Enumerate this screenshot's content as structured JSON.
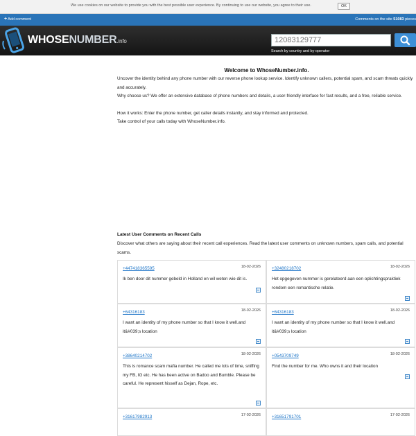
{
  "cookie": {
    "message": "We use cookies on our website to provide you with the best possible user experience. By continuing to use our website, you agree to their use.",
    "ok_label": "OK"
  },
  "topbar": {
    "add_comment_label": "Add comment",
    "comments_prefix": "Comments on the site",
    "comments_count": "51083",
    "comments_suffix": "pieces"
  },
  "header": {
    "logo_word": "WHOSE",
    "logo_word2": "NUMBER",
    "logo_tld": ".info",
    "search_placeholder": "12083129777",
    "search_sub": "Search by country and by operator"
  },
  "main": {
    "welcome_title": "Welcome to WhoseNumber.info.",
    "paragraphs": [
      "Uncover the identity behind any phone number with our reverse phone lookup service. Identify unknown callers, potential spam, and scam threats quickly and accurately.",
      "Why choose us? We offer an extensive database of phone numbers and details, a user-friendly interface for fast results, and a free, reliable service.",
      "How it works: Enter the phone number, get caller details instantly, and stay informed and protected.",
      "Take control of your calls today with WhoseNumber.info."
    ],
    "latest_title": "Latest User Comments on Recent Calls",
    "latest_desc": "Discover what others are saying about their recent call experiences. Read the latest user comments on unknown numbers, spam calls, and potential scams."
  },
  "comments": [
    {
      "phone": "+447418365595",
      "date": "18-02-2026",
      "text": "Ik ben door dit nummer gebeld in Holland en wil weten wie dit is."
    },
    {
      "phone": "+32480218702",
      "date": "18-02-2026",
      "text": "Het opgegeven nummer is gerelateerd aan een oplichtingspraktiek rondom een romantische relatie."
    },
    {
      "phone": "+64316183",
      "date": "18-02-2026",
      "text": "I want an identity of my phone number so that I know it well.and it&#039;s location"
    },
    {
      "phone": "+64316183",
      "date": "18-02-2026",
      "text": "I want an identity of my phone number so that I know it well.and it&#039;s location"
    },
    {
      "phone": "+38640214702",
      "date": "18-02-2026",
      "text": "This is romance scam mafia number. He called me lots of time, sniffing my FB, IG etc. He has been active on Badoo and Bumble. Please be careful. He represent hisself as Dejan, Rope, etc."
    },
    {
      "phone": "+0543709749",
      "date": "18-02-2026",
      "text": "Find the number for me. Who owns it and their location"
    },
    {
      "phone": "+31617982913",
      "date": "17-02-2026",
      "text": ""
    },
    {
      "phone": "+31651791701",
      "date": "17-02-2026",
      "text": ""
    }
  ]
}
